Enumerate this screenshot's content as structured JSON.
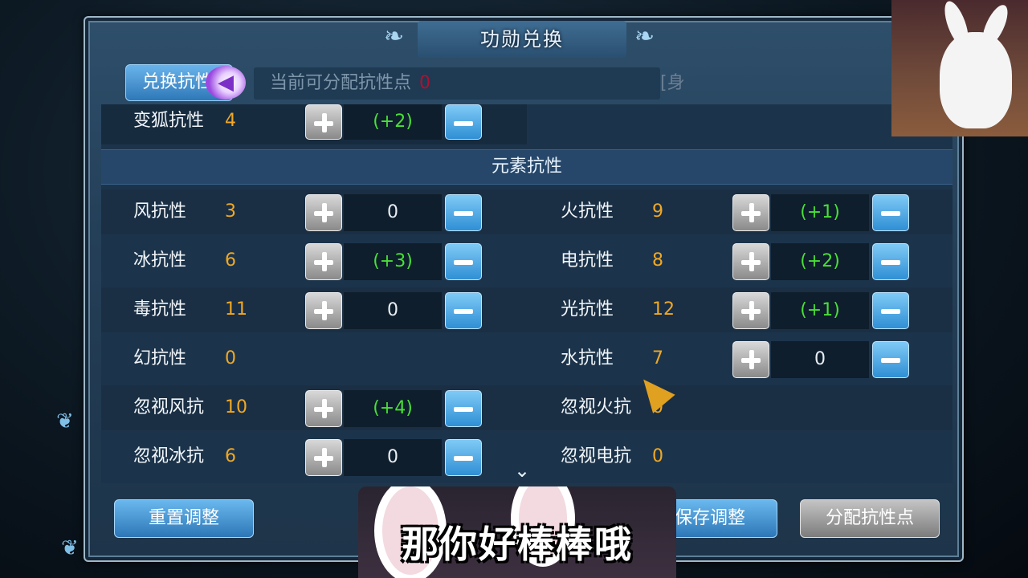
{
  "window": {
    "title": "功勋兑换"
  },
  "toolbar": {
    "exchange_label": "兑换抗性",
    "points_label": "当前可分配抗性点",
    "points_value": "0",
    "bracket_text": "[身"
  },
  "top_row": {
    "label": "变狐抗性",
    "value": "4",
    "adjust": "(+2)"
  },
  "section": {
    "title": "元素抗性"
  },
  "left_rows": [
    {
      "label": "风抗性",
      "value": "3",
      "adjust": "0"
    },
    {
      "label": "冰抗性",
      "value": "6",
      "adjust": "(+3)"
    },
    {
      "label": "毒抗性",
      "value": "11",
      "adjust": "0"
    },
    {
      "label": "幻抗性",
      "value": "0",
      "adjust": ""
    },
    {
      "label": "忽视风抗",
      "value": "10",
      "adjust": "(+4)"
    },
    {
      "label": "忽视冰抗",
      "value": "6",
      "adjust": "0"
    }
  ],
  "right_rows": [
    {
      "label": "火抗性",
      "value": "9",
      "adjust": "(+1)"
    },
    {
      "label": "电抗性",
      "value": "8",
      "adjust": "(+2)"
    },
    {
      "label": "光抗性",
      "value": "12",
      "adjust": "(+1)"
    },
    {
      "label": "水抗性",
      "value": "7",
      "adjust": "0"
    },
    {
      "label": "忽视火抗",
      "value": "0",
      "adjust": ""
    },
    {
      "label": "忽视电抗",
      "value": "0",
      "adjust": ""
    }
  ],
  "footer": {
    "reset_label": "重置调整",
    "save_label": "保存调整",
    "allocate_label": "分配抗性点"
  },
  "overlay": {
    "subtitle": "那你好棒棒哦"
  },
  "colors": {
    "accent_green": "#48e038",
    "value_orange": "#f0a825",
    "points_red": "#b01030"
  }
}
